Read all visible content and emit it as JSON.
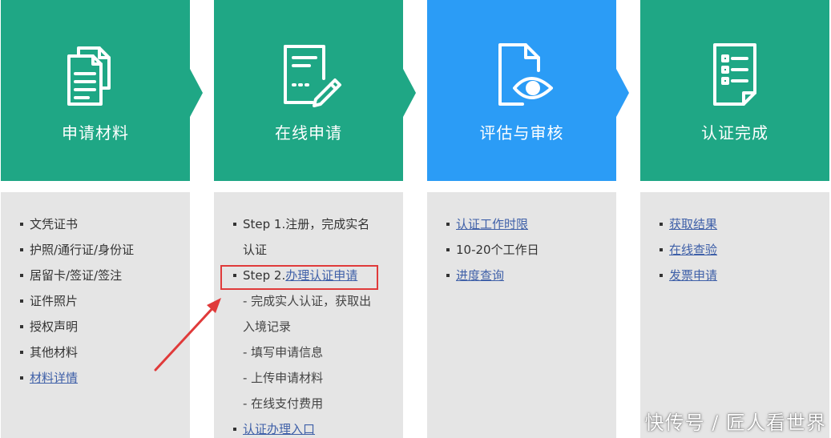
{
  "steps": [
    {
      "title": "申请材料",
      "icon": "documents-icon",
      "items": [
        {
          "text": "文凭证书",
          "link": false
        },
        {
          "text": "护照/通行证/身份证",
          "link": false
        },
        {
          "text": "居留卡/签证/签注",
          "link": false
        },
        {
          "text": "证件照片",
          "link": false
        },
        {
          "text": "授权声明",
          "link": false
        },
        {
          "text": "其他材料",
          "link": false
        },
        {
          "text": "材料详情",
          "link": true
        }
      ]
    },
    {
      "title": "在线申请",
      "icon": "form-edit-icon",
      "step1_line1": "Step 1.注册，完成实名",
      "step1_line2": "认证",
      "step2_prefix": "Step 2.",
      "step2_link": "办理认证申请",
      "sub1_line1": "- 完成实人认证，获取出",
      "sub1_line2": "入境记录",
      "sub2": "- 填写申请信息",
      "sub3": "- 上传申请材料",
      "sub4": "- 在线支付费用",
      "entry_link": "认证办理入口"
    },
    {
      "title": "评估与审核",
      "icon": "document-eye-icon",
      "items": [
        {
          "text": "认证工作时限",
          "link": true
        },
        {
          "text": "10-20个工作日",
          "link": false
        },
        {
          "text": "进度查询",
          "link": true
        }
      ]
    },
    {
      "title": "认证完成",
      "icon": "checklist-icon",
      "items": [
        {
          "text": "获取结果",
          "link": true
        },
        {
          "text": "在线查验",
          "link": true
        },
        {
          "text": "发票申请",
          "link": true
        }
      ]
    }
  ],
  "colors": {
    "green": "#1fa785",
    "blue": "#2b9cf6",
    "panel": "#e5e5e5",
    "link": "#3f60a8",
    "annotation": "#e03a3a"
  },
  "watermark": "快传号 / 匠人看世界"
}
